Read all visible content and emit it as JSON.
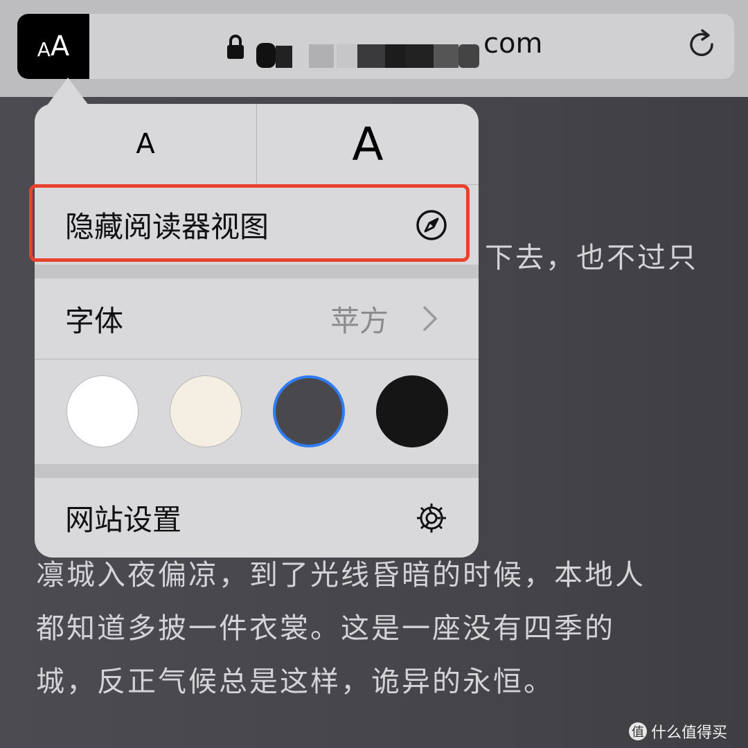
{
  "toolbar": {
    "aa_small": "A",
    "aa_large": "A",
    "url_suffix": "com",
    "lock_icon": "lock-icon",
    "reload_icon": "reload-icon"
  },
  "reader": {
    "lines": [
      "下去，也不过只",
      "凛城入夜偏凉，到了光线昏暗的时候，本地人",
      "都知道多披一件衣裳。这是一座没有四季的",
      "城，反正气候总是这样，诡异的永恒。"
    ]
  },
  "popover": {
    "font_smaller": "A",
    "font_larger": "A",
    "hide_reader": "隐藏阅读器视图",
    "hide_reader_icon": "compass-icon",
    "font_label": "字体",
    "font_value": "苹方",
    "website_settings": "网站设置",
    "settings_icon": "gear-icon",
    "themes": [
      {
        "name": "white",
        "color": "#ffffff",
        "selected": false
      },
      {
        "name": "sepia",
        "color": "#f5efe3",
        "selected": false
      },
      {
        "name": "gray",
        "color": "#48484d",
        "selected": true
      },
      {
        "name": "black",
        "color": "#151515",
        "selected": false
      }
    ],
    "highlight_color": "#e8412e",
    "selected_ring_color": "#2f7cf6"
  },
  "watermark": {
    "badge": "值",
    "text": "什么值得买"
  }
}
